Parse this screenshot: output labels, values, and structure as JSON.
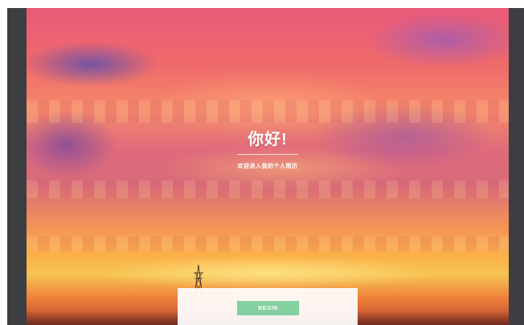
{
  "hero": {
    "title": "你好!",
    "subtitle": "欢迎进入我的个人简历"
  },
  "panel": {
    "begin_label": "BEGIN"
  },
  "colors": {
    "frame": "#3d3e42",
    "button": "#83d0a1",
    "panel": "#ffffff"
  },
  "icons": {
    "pylon": "transmission-tower-icon"
  }
}
